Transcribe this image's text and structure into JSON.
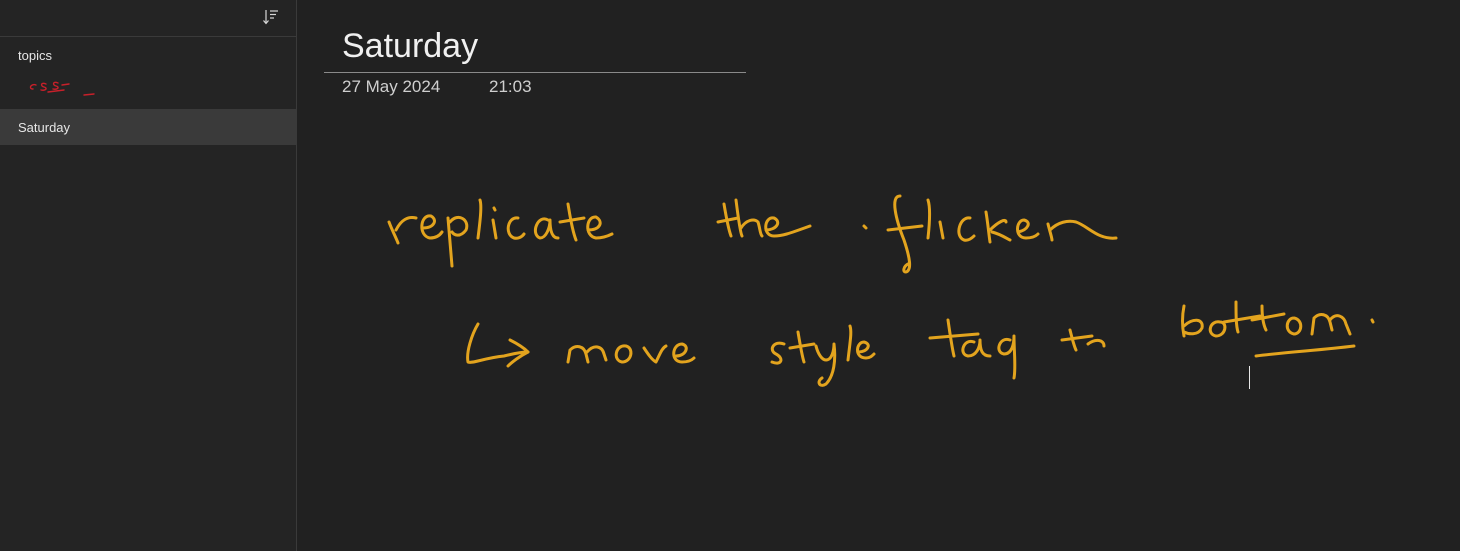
{
  "sidebar": {
    "sort_icon": "sort-descending-icon",
    "section": {
      "title": "topics",
      "thumbnail_ink_color": "#c8202a"
    },
    "pages": [
      {
        "label": "Saturday",
        "selected": true
      }
    ]
  },
  "page": {
    "title": "Saturday",
    "date": "27 May 2024",
    "time": "21:03",
    "ink_color": "#e3a41e",
    "handwriting": [
      "replicate the flicker",
      "↳ move style tag to bottom."
    ]
  },
  "colors": {
    "background": "#212121",
    "sidebar": "#242424",
    "selected_item": "#3a3a3a",
    "divider": "#3a3a3a"
  }
}
